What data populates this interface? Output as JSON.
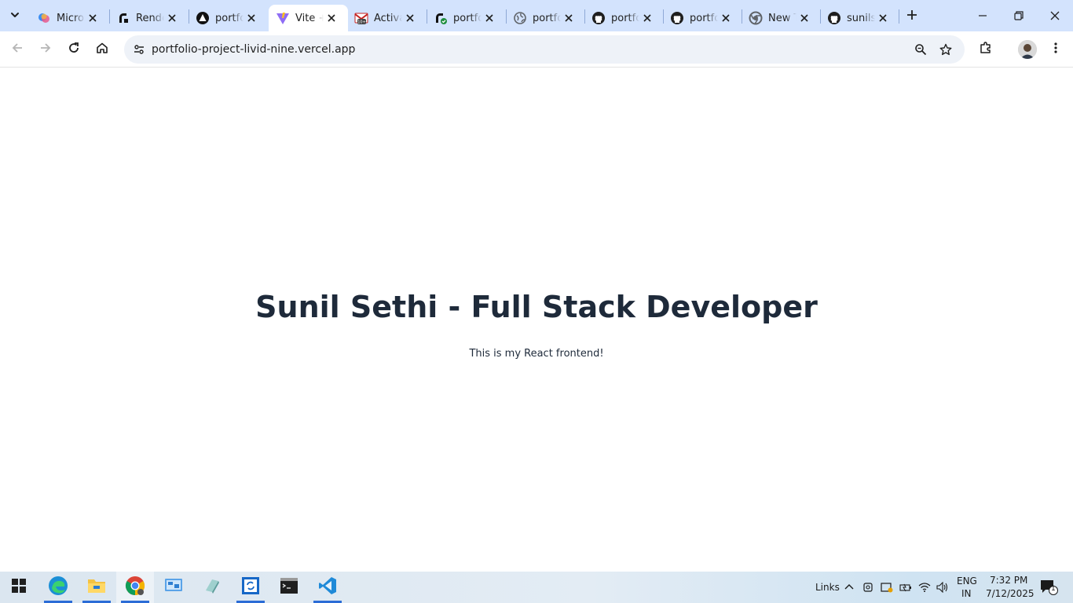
{
  "browser": {
    "tabs": [
      {
        "title": "Microsoft Copilot",
        "icon": "copilot-icon"
      },
      {
        "title": "Render",
        "icon": "render-icon"
      },
      {
        "title": "portfolio",
        "icon": "triangle-logo-icon"
      },
      {
        "title": "Vite + React",
        "icon": "vite-icon",
        "active": true
      },
      {
        "title": "Activate",
        "icon": "gmail-icon"
      },
      {
        "title": "portfolio",
        "icon": "vercel-check-icon"
      },
      {
        "title": "portfolio",
        "icon": "globe-icon"
      },
      {
        "title": "portfolio",
        "icon": "github-icon"
      },
      {
        "title": "portfolio",
        "icon": "github-icon"
      },
      {
        "title": "New Tab",
        "icon": "chrome-icon"
      },
      {
        "title": "sunilsethi",
        "icon": "github-icon"
      }
    ],
    "url": "portfolio-project-livid-nine.vercel.app",
    "accent": "#d3e3fd"
  },
  "page": {
    "heading": "Sunil Sethi - Full Stack Developer",
    "subtext": "This is my React frontend!",
    "text_color": "#1e2a3a"
  },
  "taskbar": {
    "links_label": "Links",
    "lang_top": "ENG",
    "lang_bottom": "IN",
    "time": "7:32 PM",
    "date": "7/12/2025",
    "notification_count": "1"
  }
}
